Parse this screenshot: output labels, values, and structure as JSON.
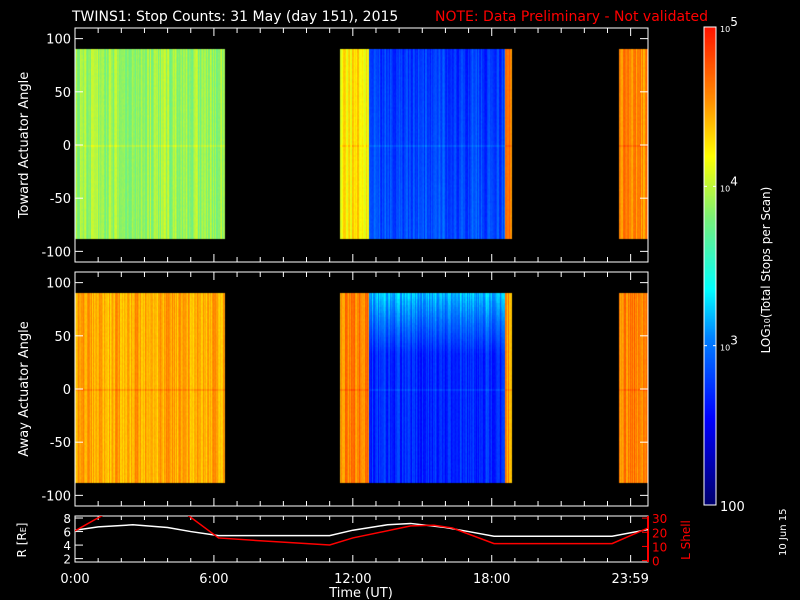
{
  "title": "TWINS1: Stop Counts: 31 May (day 151), 2015",
  "note": "NOTE: Data Preliminary - Not validated",
  "date_stamp": "10 Jun 15",
  "colors": {
    "background": "#000000",
    "axes": "#ffffff",
    "note": "#ff0000",
    "lshell": "#ff0000",
    "r_line": "#ffffff"
  },
  "chart_data": [
    {
      "type": "heatmap",
      "ylabel": "Toward Actuator Angle",
      "ylim": [
        -110,
        110
      ],
      "yticks": [
        "100",
        "50",
        "0",
        "-50",
        "-100"
      ],
      "ytick_values": [
        100,
        50,
        0,
        -50,
        -100
      ],
      "data_angle_range": [
        -88,
        90
      ],
      "xlim_hours": [
        0,
        24.75
      ],
      "segments": [
        {
          "start": 0.0,
          "end": 6.45,
          "log_counts": 3.9
        },
        {
          "start": 11.45,
          "end": 12.7,
          "log_counts": 4.25
        },
        {
          "start": 12.7,
          "end": 18.6,
          "log_counts": 2.75
        },
        {
          "start": 18.6,
          "end": 18.85,
          "log_counts": 4.6
        },
        {
          "start": 23.5,
          "end": 24.75,
          "log_counts": 4.55
        }
      ]
    },
    {
      "type": "heatmap",
      "ylabel": "Away Actuator Angle",
      "ylim": [
        -110,
        110
      ],
      "yticks": [
        "100",
        "50",
        "0",
        "-50",
        "-100"
      ],
      "ytick_values": [
        100,
        50,
        0,
        -50,
        -100
      ],
      "data_angle_range": [
        -88,
        90
      ],
      "xlim_hours": [
        0,
        24.75
      ],
      "segments": [
        {
          "start": 0.0,
          "end": 6.45,
          "log_counts": 4.45
        },
        {
          "start": 11.45,
          "end": 12.7,
          "log_counts": 4.6
        },
        {
          "start": 12.7,
          "end": 18.6,
          "log_counts": 2.7
        },
        {
          "start": 18.6,
          "end": 18.85,
          "log_counts": 4.5
        },
        {
          "start": 23.5,
          "end": 24.75,
          "log_counts": 4.6
        }
      ]
    },
    {
      "type": "line",
      "xlabel": "Time (UT)",
      "ylabel": "R [R",
      "ylabel_sub": "E",
      "ylabel_end": "]",
      "y2label": "L Shell",
      "ylim": [
        1.5,
        8.3
      ],
      "y2lim": [
        -1,
        31.5
      ],
      "yticks": [
        "8",
        "6",
        "4",
        "2"
      ],
      "ytick_values": [
        8,
        6,
        4,
        2
      ],
      "y2ticks": [
        "30",
        "20",
        "10",
        "0"
      ],
      "y2tick_values": [
        30,
        20,
        10,
        0
      ],
      "xticks": [
        "0:00",
        "6:00",
        "12:00",
        "18:00",
        "23:59"
      ],
      "xtick_hours": [
        0,
        6,
        12,
        18,
        23.98
      ],
      "series": [
        {
          "name": "R",
          "x": [
            0,
            1,
            2.5,
            4,
            5,
            6.2,
            11,
            12,
            13.5,
            14.5,
            16,
            17,
            18.1,
            23.2,
            24.75
          ],
          "y": [
            6.2,
            6.7,
            7.0,
            6.6,
            6.0,
            5.4,
            5.4,
            6.2,
            7.0,
            7.2,
            6.6,
            6.0,
            5.3,
            5.3,
            6.3
          ]
        },
        {
          "name": "L Shell",
          "x": [
            0,
            1.3,
            4.8,
            6.2,
            8,
            11,
            12,
            14.5,
            15.5,
            16.3,
            18.1,
            23.2,
            24.75
          ],
          "y": [
            21,
            33,
            33,
            16,
            14,
            11,
            16,
            24.5,
            25,
            23,
            12,
            12,
            23
          ]
        }
      ]
    },
    {
      "type": "colorbar",
      "label": "LOG",
      "label_sub": "10",
      "label_rest": "(Total Stops per Scan)",
      "range_log": [
        2,
        5
      ],
      "ticks": [
        {
          "base": "10",
          "exp": "5",
          "log": 5
        },
        {
          "base": "10",
          "exp": "4",
          "log": 4
        },
        {
          "base": "10",
          "exp": "3",
          "log": 3
        },
        {
          "base": "100",
          "exp": "",
          "log": 2
        }
      ]
    }
  ]
}
